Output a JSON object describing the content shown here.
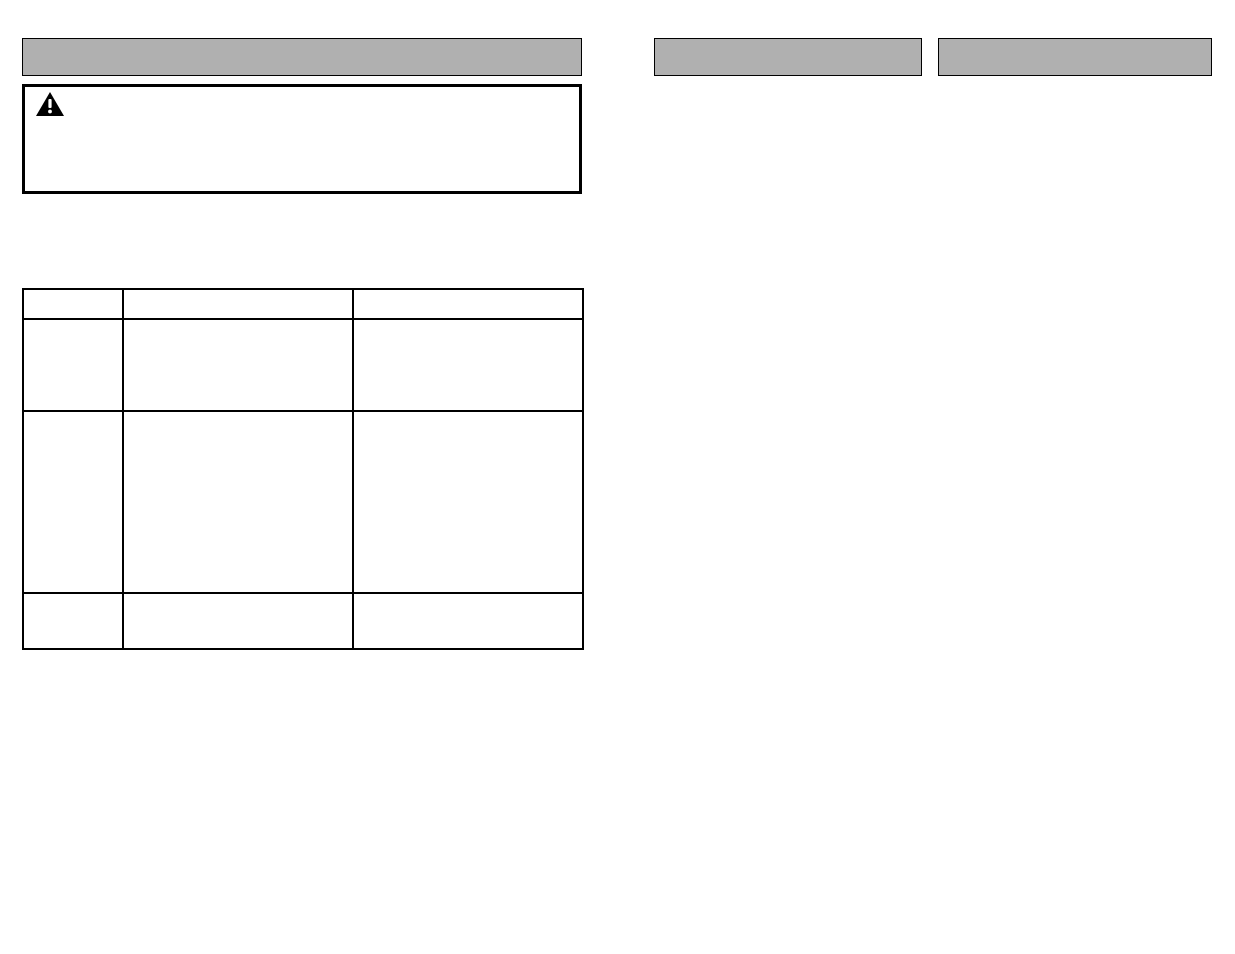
{
  "left": {
    "section_header": "",
    "warning": {
      "label": "",
      "text": ""
    },
    "table": {
      "headers": [
        "",
        "",
        ""
      ],
      "rows": [
        [
          "",
          "",
          ""
        ],
        [
          "",
          "",
          ""
        ],
        [
          "",
          "",
          ""
        ]
      ]
    }
  },
  "mid": {
    "section_header": ""
  },
  "right": {
    "section_header": ""
  }
}
